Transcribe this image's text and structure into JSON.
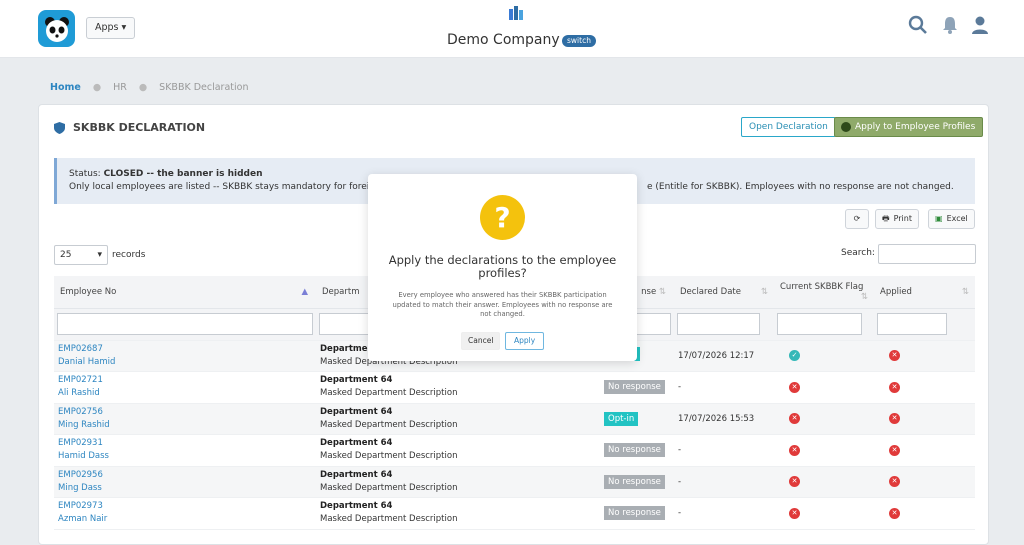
{
  "header": {
    "apps_label": "Apps",
    "company": "Demo Company",
    "switch_label": "switch"
  },
  "breadcrumb": [
    "Home",
    "HR",
    "SKBBK Declaration"
  ],
  "card": {
    "title": "SKBBK DECLARATION",
    "open_label": "Open Declaration",
    "apply_label": "Apply to Employee Profiles"
  },
  "banner": {
    "status_prefix": "Status: ",
    "status_value": "CLOSED -- the banner is hidden",
    "line2_left": "Only local employees are listed -- SKBBK stays mandatory for foreign",
    "line2_right": "e (Entitle for SKBBK). Employees with no response are not changed."
  },
  "toolbar": {
    "print_label": "Print",
    "excel_label": "Excel"
  },
  "table_controls": {
    "page_length": "25",
    "records_label": "records",
    "search_label": "Search:"
  },
  "columns": [
    "Employee No",
    "Departm",
    "nse",
    "Declared Date",
    "Current SKBBK Flag",
    "Applied"
  ],
  "rows": [
    {
      "no": "EMP02687",
      "name": "Danial Hamid",
      "dept": "Department",
      "desc": "Masked Department Description",
      "resp": "",
      "resp_type": "in",
      "date": "17/07/2026 12:17",
      "flag": "ok",
      "applied": "x"
    },
    {
      "no": "EMP02721",
      "name": "Ali Rashid",
      "dept": "Department 64",
      "desc": "Masked Department Description",
      "resp": "No response",
      "resp_type": "no",
      "date": "-",
      "flag": "x",
      "applied": "x"
    },
    {
      "no": "EMP02756",
      "name": "Ming Rashid",
      "dept": "Department 64",
      "desc": "Masked Department Description",
      "resp": "Opt-in",
      "resp_type": "in",
      "date": "17/07/2026 15:53",
      "flag": "x",
      "applied": "x"
    },
    {
      "no": "EMP02931",
      "name": "Hamid Dass",
      "dept": "Department 64",
      "desc": "Masked Department Description",
      "resp": "No response",
      "resp_type": "no",
      "date": "-",
      "flag": "x",
      "applied": "x"
    },
    {
      "no": "EMP02956",
      "name": "Ming Dass",
      "dept": "Department 64",
      "desc": "Masked Department Description",
      "resp": "No response",
      "resp_type": "no",
      "date": "-",
      "flag": "x",
      "applied": "x"
    },
    {
      "no": "EMP02973",
      "name": "Azman Nair",
      "dept": "Department 64",
      "desc": "Masked Department Description",
      "resp": "No response",
      "resp_type": "no",
      "date": "-",
      "flag": "x",
      "applied": "x"
    }
  ],
  "modal": {
    "title": "Apply the declarations to the employee profiles?",
    "text": "Every employee who answered has their SKBBK participation updated to match their answer. Employees with no response are not changed.",
    "cancel_label": "Cancel",
    "apply_label": "Apply",
    "icon": "?"
  }
}
